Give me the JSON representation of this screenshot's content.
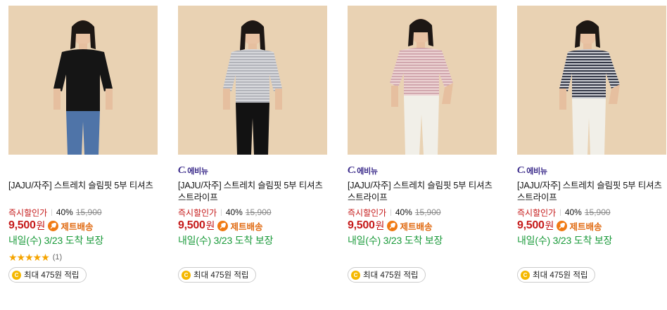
{
  "products": [
    {
      "brand": "",
      "title": "[JAJU/자주] 스트레치 슬림핏 5부 티셔츠",
      "discount_label": "즉시할인가",
      "discount_pct": "40%",
      "original_price": "15,900",
      "price": "9,500",
      "currency": "원",
      "shipping_label": "제트배송",
      "delivery": "내일(수) 3/23 도착 보장",
      "rating": 5,
      "review_count": "(1)",
      "points": "최대 475원 적립",
      "shirt": "black"
    },
    {
      "brand": "에비뉴",
      "title": "[JAJU/자주] 스트레치 슬림핏 5부 티셔츠 스트라이프",
      "discount_label": "즉시할인가",
      "discount_pct": "40%",
      "original_price": "15,900",
      "price": "9,500",
      "currency": "원",
      "shipping_label": "제트배송",
      "delivery": "내일(수) 3/23 도착 보장",
      "points": "최대 475원 적립",
      "shirt": "grey-stripe"
    },
    {
      "brand": "에비뉴",
      "title": "[JAJU/자주] 스트레치 슬림핏 5부 티셔츠 스트라이프",
      "discount_label": "즉시할인가",
      "discount_pct": "40%",
      "original_price": "15,900",
      "price": "9,500",
      "currency": "원",
      "shipping_label": "제트배송",
      "delivery": "내일(수) 3/23 도착 보장",
      "points": "최대 475원 적립",
      "shirt": "pink-stripe"
    },
    {
      "brand": "에비뉴",
      "title": "[JAJU/자주] 스트레치 슬림핏 5부 티셔츠 스트라이프",
      "discount_label": "즉시할인가",
      "discount_pct": "40%",
      "original_price": "15,900",
      "price": "9,500",
      "currency": "원",
      "shipping_label": "제트배송",
      "delivery": "내일(수) 3/23 도착 보장",
      "points": "최대 475원 적립",
      "shirt": "navy-stripe"
    }
  ],
  "brand_logo_letter": "C.",
  "coin_symbol": "C",
  "colors": {
    "price_red": "#c51a1a",
    "delivery_green": "#1a9a3a",
    "jet_orange": "#f07a14",
    "background_photo": "#e8d0b0"
  }
}
